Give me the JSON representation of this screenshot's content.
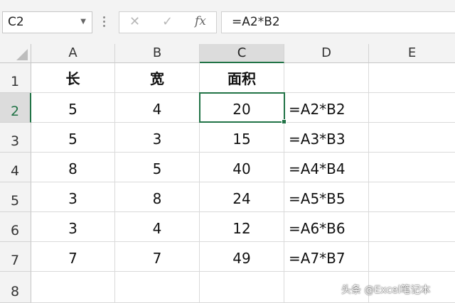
{
  "formula_bar": {
    "name_box": "C2",
    "cancel_icon": "✕",
    "enter_icon": "✓",
    "fx_label": "fx",
    "formula": "=A2*B2"
  },
  "columns": [
    "A",
    "B",
    "C",
    "D",
    "E"
  ],
  "selected_column": "C",
  "rows": [
    {
      "num": "1",
      "cells": [
        "长",
        "宽",
        "面积",
        "",
        ""
      ]
    },
    {
      "num": "2",
      "cells": [
        "5",
        "4",
        "20",
        "=A2*B2",
        ""
      ]
    },
    {
      "num": "3",
      "cells": [
        "5",
        "3",
        "15",
        "=A3*B3",
        ""
      ]
    },
    {
      "num": "4",
      "cells": [
        "8",
        "5",
        "40",
        "=A4*B4",
        ""
      ]
    },
    {
      "num": "5",
      "cells": [
        "3",
        "8",
        "24",
        "=A5*B5",
        ""
      ]
    },
    {
      "num": "6",
      "cells": [
        "3",
        "4",
        "12",
        "=A6*B6",
        ""
      ]
    },
    {
      "num": "7",
      "cells": [
        "7",
        "7",
        "49",
        "=A7*B7",
        ""
      ]
    },
    {
      "num": "8",
      "cells": [
        "",
        "",
        "",
        "",
        ""
      ]
    }
  ],
  "selected_row": "2",
  "watermark": "头条 @Excel笔记本",
  "accent_color": "#217346"
}
